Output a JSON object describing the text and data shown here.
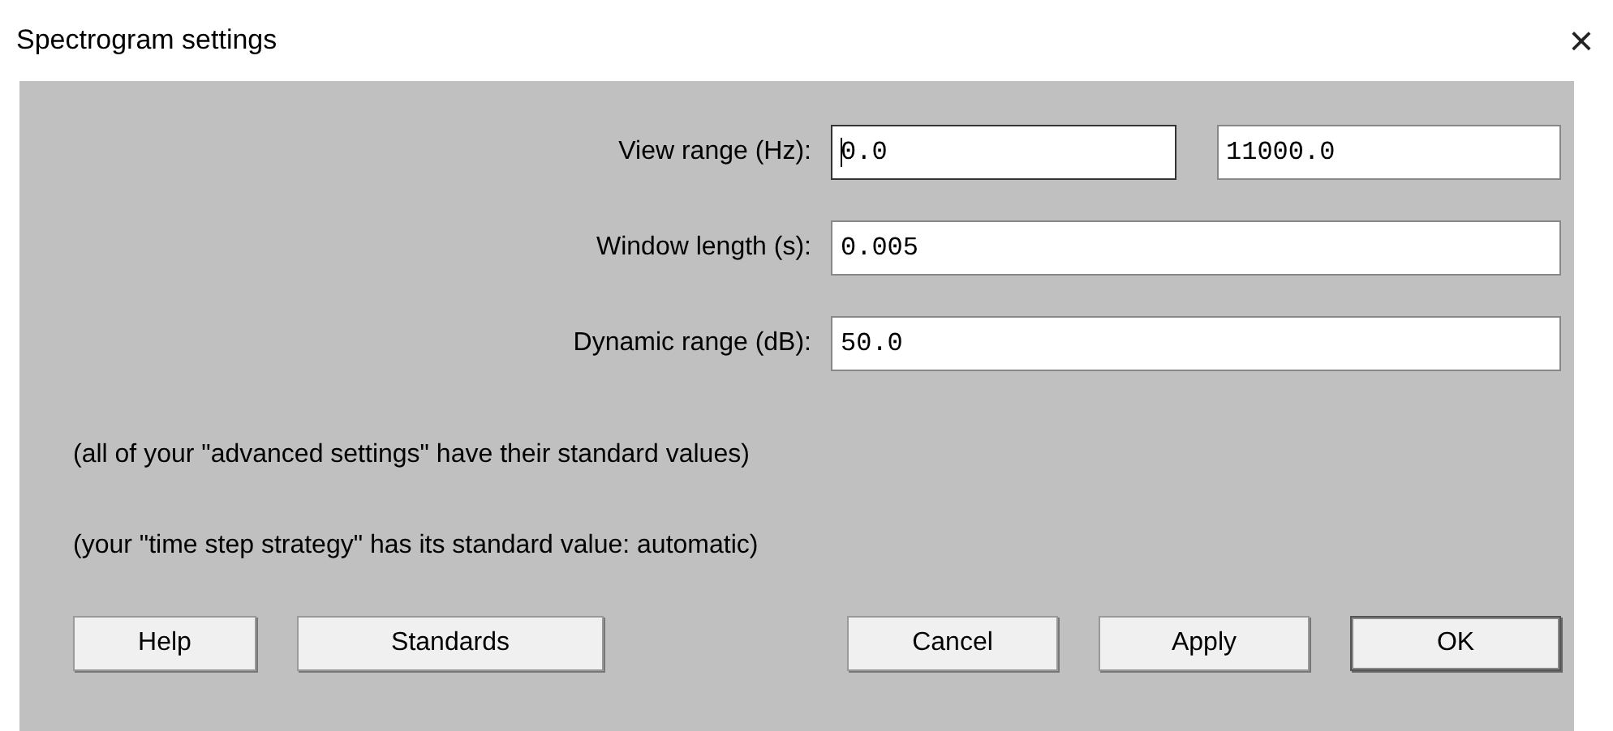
{
  "window": {
    "title": "Spectrogram settings",
    "close": "×"
  },
  "fields": [
    {
      "label": "View range (Hz):",
      "values": [
        "0.0",
        "11000.0"
      ],
      "focused": true
    },
    {
      "label": "Window length (s):",
      "values": [
        "0.005"
      ],
      "focused": false
    },
    {
      "label": "Dynamic range (dB):",
      "values": [
        "50.0"
      ],
      "focused": false
    }
  ],
  "notes": [
    "(all of your \"advanced settings\" have their standard values)",
    "(your \"time step strategy\" has its standard value: automatic)"
  ],
  "buttons_left": [
    {
      "label": "Help",
      "default": false
    },
    {
      "label": "Standards",
      "default": false
    }
  ],
  "buttons_right": [
    {
      "label": "Cancel",
      "default": false
    },
    {
      "label": "Apply",
      "default": false
    },
    {
      "label": "OK",
      "default": true
    }
  ]
}
